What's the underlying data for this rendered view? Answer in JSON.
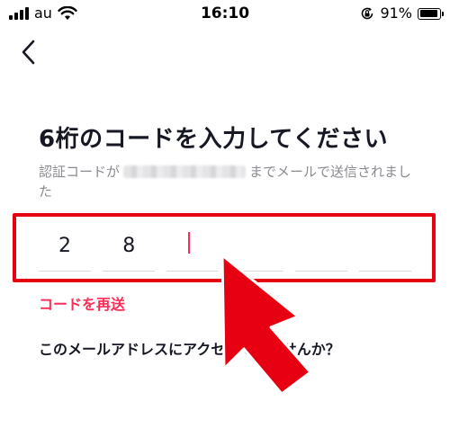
{
  "status_bar": {
    "carrier": "au",
    "time": "16:10",
    "battery_percent": "91%",
    "battery_level": 0.91
  },
  "icons": {
    "back": "chevron-left-icon",
    "wifi": "wifi-icon",
    "rotation_lock": "rotation-lock-icon",
    "battery": "battery-icon",
    "annotation": "red-arrow-annotation"
  },
  "main": {
    "title": "6桁のコードを入力してください",
    "subtitle_prefix": "認証コードが",
    "subtitle_suffix": "までメールで送信されました",
    "code_digits": [
      "2",
      "8",
      "",
      "",
      "",
      ""
    ],
    "active_index": 2,
    "resend_label": "コードを再送",
    "no_access_label": "このメールアドレスにアクセスできませんか？"
  },
  "colors": {
    "accent": "#fe2c55",
    "annotation": "#e60012",
    "text": "#161823",
    "muted": "#8a8b91"
  }
}
